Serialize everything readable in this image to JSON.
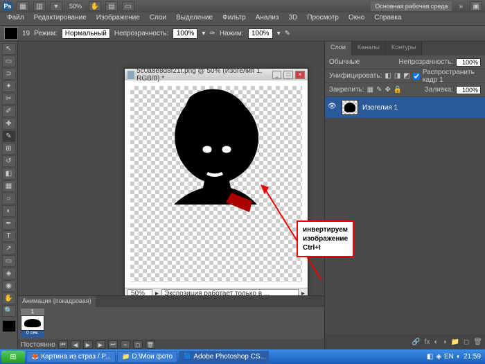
{
  "titlebar": {
    "zoom": "50%",
    "workspace": "Основная рабочая среда"
  },
  "menu": [
    "Файл",
    "Редактирование",
    "Изображение",
    "Слои",
    "Выделение",
    "Фильтр",
    "Анализ",
    "3D",
    "Просмотр",
    "Окно",
    "Справка"
  ],
  "options": {
    "tool_size": "19",
    "mode_label": "Режим:",
    "mode_value": "Нормальный",
    "opacity_label": "Непрозрачность:",
    "opacity_value": "100%",
    "flow_label": "Нажим:",
    "flow_value": "100%"
  },
  "document": {
    "title": "5c0a8e8d8f21t.png @ 50% (Изогелия 1, RGB/8) *",
    "zoom": "50%",
    "status": "Экспозиция работает только в ..."
  },
  "annotation": {
    "line1": "инвертируем",
    "line2": "изображение Ctrl+I"
  },
  "layers_panel": {
    "tabs": [
      "Слои",
      "Каналы",
      "Контуры"
    ],
    "blend": "Обычные",
    "opacity_label": "Непрозрачность:",
    "opacity": "100%",
    "unify_label": "Унифицировать:",
    "propagate": "Распространить кадр 1",
    "lock_label": "Закрепить:",
    "fill_label": "Заливка:",
    "fill": "100%",
    "layer_name": "Изогелия 1"
  },
  "animation": {
    "title": "Анимация (покадровая)",
    "frame_num": "1",
    "frame_dur": "0 сек.",
    "loop": "Постоянно"
  },
  "taskbar": {
    "items": [
      "Картина из страз / P...",
      "D:\\Мои фото",
      "Adobe Photoshop CS..."
    ],
    "lang": "EN",
    "time": "21:59"
  }
}
